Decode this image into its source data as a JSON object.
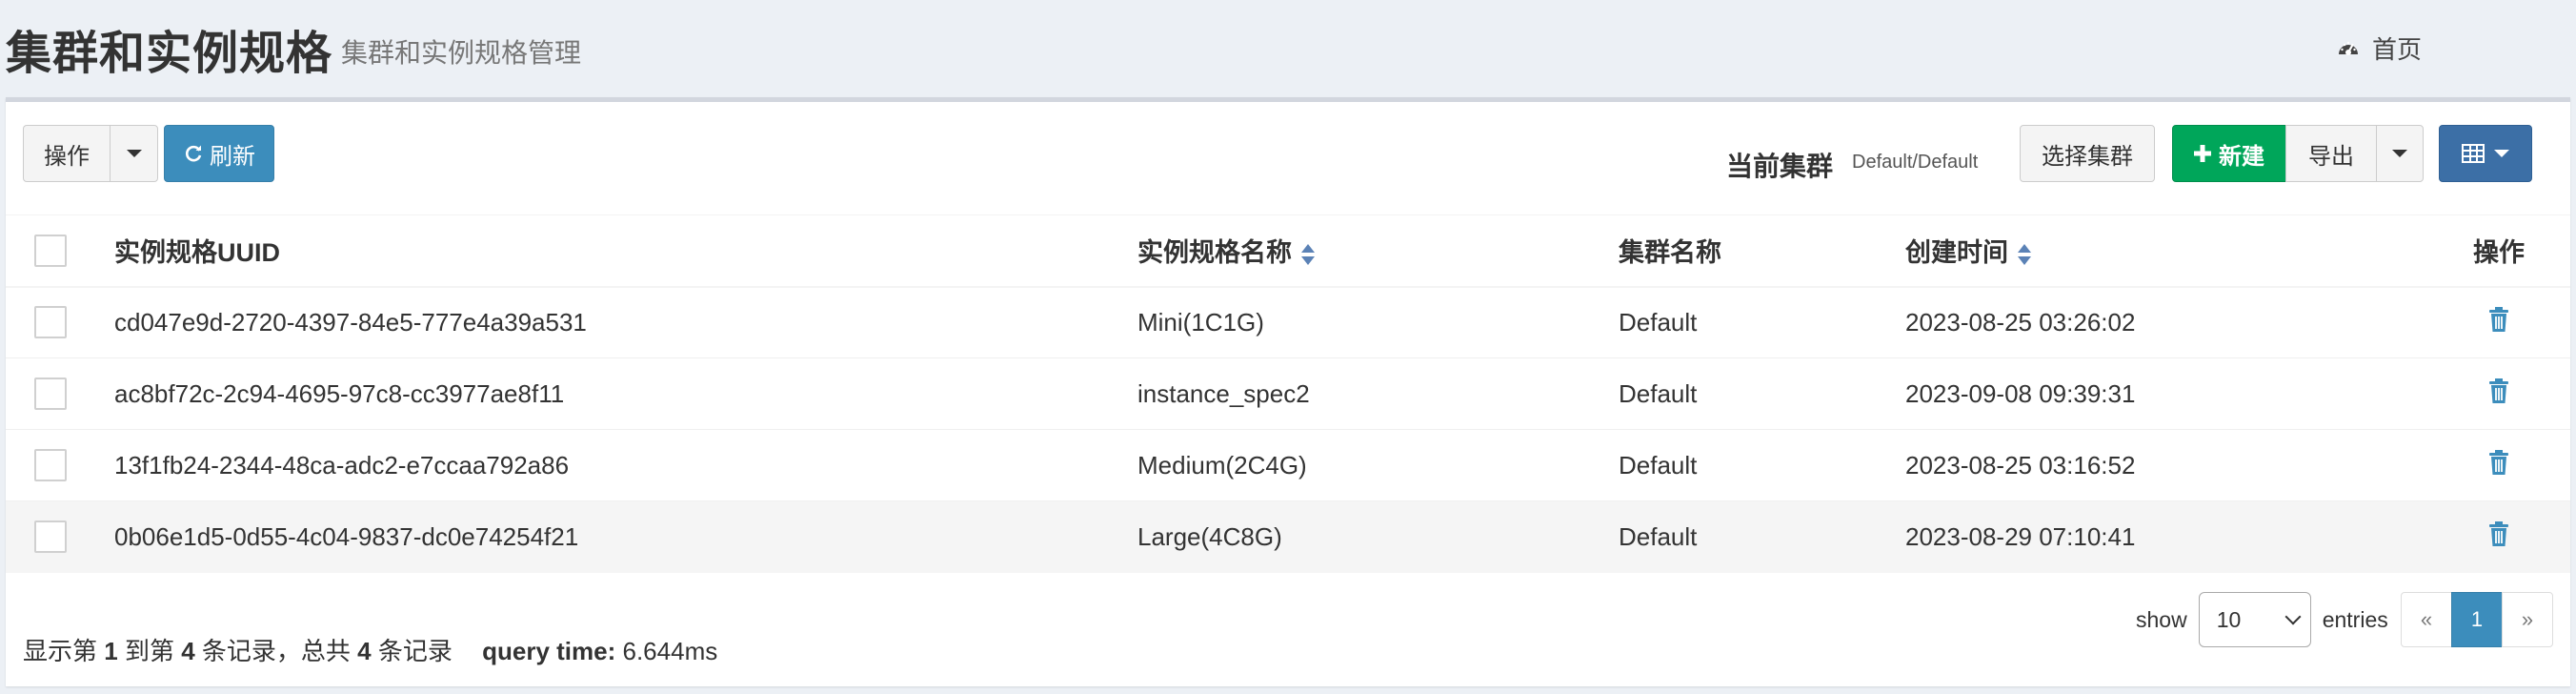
{
  "header": {
    "title": "集群和实例规格",
    "subtitle": "集群和实例规格管理",
    "home_label": "首页"
  },
  "toolbar": {
    "operations_label": "操作",
    "refresh_label": "刷新",
    "current_cluster_label": "当前集群",
    "current_cluster_value": "Default/Default",
    "select_cluster_label": "选择集群",
    "new_label": "新建",
    "export_label": "导出"
  },
  "table": {
    "columns": {
      "uuid": "实例规格UUID",
      "name": "实例规格名称",
      "cluster": "集群名称",
      "created": "创建时间",
      "actions": "操作"
    },
    "rows": [
      {
        "uuid": "cd047e9d-2720-4397-84e5-777e4a39a531",
        "name": "Mini(1C1G)",
        "cluster": "Default",
        "created": "2023-08-25 03:26:02"
      },
      {
        "uuid": "ac8bf72c-2c94-4695-97c8-cc3977ae8f11",
        "name": "instance_spec2",
        "cluster": "Default",
        "created": "2023-09-08 09:39:31"
      },
      {
        "uuid": "13f1fb24-2344-48ca-adc2-e7ccaa792a86",
        "name": "Medium(2C4G)",
        "cluster": "Default",
        "created": "2023-08-25 03:16:52"
      },
      {
        "uuid": "0b06e1d5-0d55-4c04-9837-dc0e74254f21",
        "name": "Large(4C8G)",
        "cluster": "Default",
        "created": "2023-08-29 07:10:41"
      }
    ]
  },
  "footer": {
    "info_prefix": "显示第",
    "info_start": "1",
    "info_mid": "到第",
    "info_end": "4",
    "info_mid2": "条记录，总共",
    "info_total": "4",
    "info_suffix": "条记录",
    "query_time_label": "query time:",
    "query_time_value": "6.644ms",
    "show_label": "show",
    "entries_value": "10",
    "entries_label": "entries",
    "pager_prev": "«",
    "pager_current": "1",
    "pager_next": "»"
  },
  "colors": {
    "primary": "#3c8dbc",
    "success": "#00a65a",
    "columns_button": "#3c6fa6",
    "trash": "#3c8dbc"
  }
}
